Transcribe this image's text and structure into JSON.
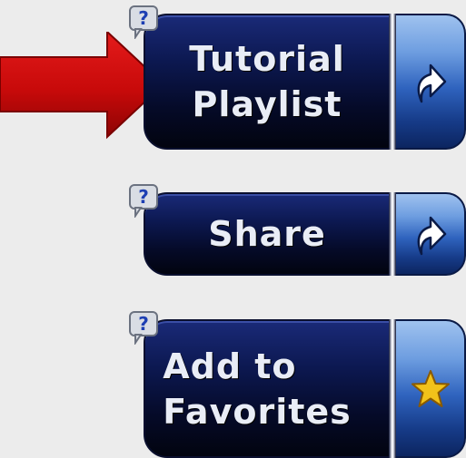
{
  "buttons": [
    {
      "label": "Tutorial\nPlaylist",
      "side_icon": "share-arrow-icon",
      "help": "?"
    },
    {
      "label": "Share",
      "side_icon": "share-arrow-icon",
      "help": "?"
    },
    {
      "label": "Add to\nFavorites",
      "side_icon": "star-icon",
      "help": "?"
    }
  ],
  "colors": {
    "button_dark": "#050a28",
    "button_side": "#2f63be",
    "arrow_red": "#c80a0a",
    "background": "#ececec",
    "star": "#f2c21a"
  }
}
